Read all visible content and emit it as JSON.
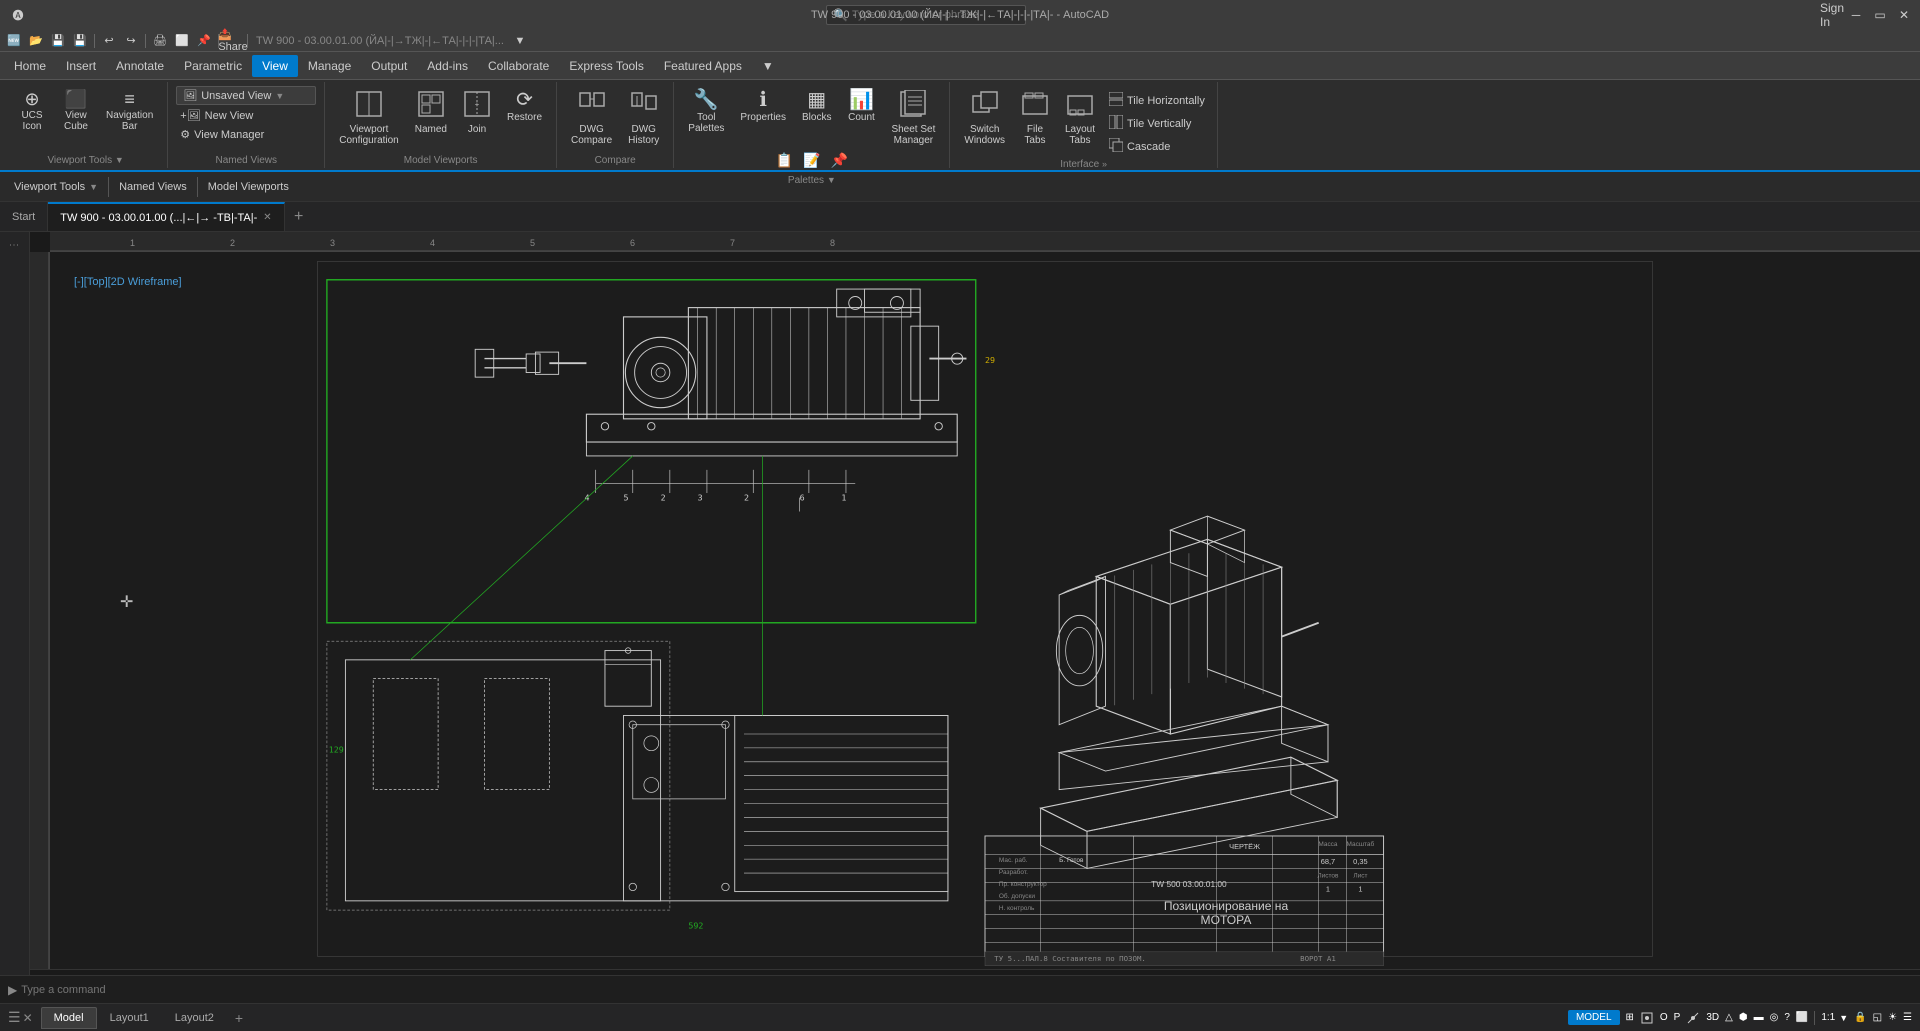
{
  "titlebar": {
    "title": "TW 900 - 03.00.01.00 (ЙА|-|→ТЖ|-|←ТА|-|-|-|ТА|- - AutoCAD",
    "search_placeholder": "Type a keyword or phrase",
    "sign_in": "Sign In",
    "minimize": "─",
    "restore": "▭",
    "close": "✕"
  },
  "qat": {
    "buttons": [
      "🆕",
      "📂",
      "💾",
      "💾",
      "↩",
      "↪",
      "⬜",
      "⬜",
      "⬜",
      "▶",
      "▶"
    ]
  },
  "menu": {
    "items": [
      "Home",
      "Insert",
      "Annotate",
      "Parametric",
      "View",
      "Manage",
      "Output",
      "Add-ins",
      "Collaborate",
      "Express Tools",
      "Featured Apps",
      "▼"
    ]
  },
  "ribbon": {
    "active_tab": "View",
    "groups": [
      {
        "name": "viewport-tools-group",
        "label": "Viewport Tools",
        "items": [
          {
            "type": "large",
            "icon": "⊞",
            "label": "UCS Icon",
            "name": "ucs-icon-btn"
          },
          {
            "type": "large",
            "icon": "⬛",
            "label": "View Cube",
            "name": "view-cube-btn"
          },
          {
            "type": "large",
            "icon": "≡",
            "label": "Navigation Bar",
            "name": "navigation-bar-btn"
          }
        ]
      },
      {
        "name": "named-views-group",
        "label": "Named Views",
        "items": [
          {
            "type": "small",
            "label": "Unsaved View",
            "name": "unsaved-view-dropdown",
            "dropdown": true
          },
          {
            "type": "small",
            "icon": "🖼",
            "label": "New View",
            "name": "new-view-btn"
          },
          {
            "type": "small",
            "icon": "⚙",
            "label": "View Manager",
            "name": "view-manager-btn"
          }
        ]
      },
      {
        "name": "model-viewports-group",
        "label": "Model Viewports",
        "items": [
          {
            "type": "large",
            "icon": "⬜",
            "label": "Viewport Configuration",
            "name": "viewport-config-btn"
          },
          {
            "type": "large",
            "icon": "📌",
            "label": "Named",
            "name": "named-btn"
          },
          {
            "type": "large",
            "icon": "🔗",
            "label": "Join",
            "name": "join-btn"
          },
          {
            "type": "large",
            "icon": "⟳",
            "label": "Restore",
            "name": "restore-btn"
          }
        ]
      },
      {
        "name": "compare-group",
        "label": "Compare",
        "items": [
          {
            "type": "large",
            "icon": "📄",
            "label": "DWG Compare",
            "name": "dwg-compare-btn"
          },
          {
            "type": "large",
            "icon": "📋",
            "label": "DWG History",
            "name": "dwg-history-btn"
          }
        ]
      },
      {
        "name": "palettes-group",
        "label": "Palettes",
        "items": [
          {
            "type": "large",
            "icon": "🔧",
            "label": "Tool Palettes",
            "name": "tool-palettes-btn"
          },
          {
            "type": "large",
            "icon": "ℹ",
            "label": "Properties",
            "name": "properties-btn"
          },
          {
            "type": "large",
            "icon": "▦",
            "label": "Blocks",
            "name": "blocks-btn"
          },
          {
            "type": "large",
            "icon": "📊",
            "label": "Count",
            "name": "count-btn"
          },
          {
            "type": "large",
            "icon": "📰",
            "label": "Sheet Set Manager",
            "name": "sheet-set-btn"
          }
        ]
      },
      {
        "name": "interface-group",
        "label": "Interface",
        "items": [
          {
            "type": "large",
            "icon": "⧉",
            "label": "Switch Windows",
            "name": "switch-windows-btn"
          },
          {
            "type": "large",
            "icon": "📁",
            "label": "File Tabs",
            "name": "file-tabs-btn"
          },
          {
            "type": "large",
            "icon": "📐",
            "label": "Layout Tabs",
            "name": "layout-tabs-btn"
          },
          {
            "type": "small",
            "icon": "⬜",
            "label": "Tile Horizontally",
            "name": "tile-h-btn"
          },
          {
            "type": "small",
            "icon": "⬜",
            "label": "Tile Vertically",
            "name": "tile-v-btn"
          },
          {
            "type": "small",
            "icon": "⬜",
            "label": "Cascade",
            "name": "cascade-btn"
          }
        ]
      }
    ]
  },
  "viewport_toolbar": {
    "items": [
      "Viewport Tools ▼",
      "Named Views",
      "Model Viewports"
    ]
  },
  "tabs": {
    "tabs": [
      {
        "label": "Start",
        "active": false,
        "closable": false
      },
      {
        "label": "TW 900 - 03.00.01.00 (...; |←|→ -TBI-TAI-",
        "active": true,
        "closable": true
      }
    ],
    "add_label": "+"
  },
  "viewport": {
    "label": "[-][Top][2D Wireframe]"
  },
  "layout_tabs": {
    "tabs": [
      "Model",
      "Layout1",
      "Layout2"
    ],
    "active": "Model"
  },
  "command": {
    "placeholder": "Type a command"
  },
  "status_bar": {
    "model": "MODEL",
    "scale": "1:1"
  }
}
